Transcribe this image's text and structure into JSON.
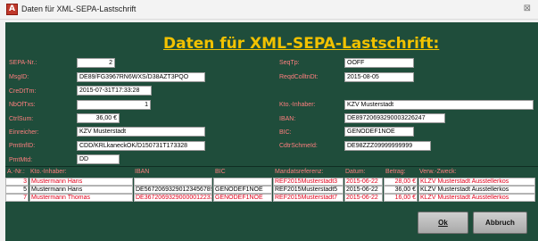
{
  "window": {
    "title": "Daten für XML-SEPA-Lastschrift",
    "close_glyph": "⊠",
    "app_icon_letter": "A"
  },
  "heading": "Daten für XML-SEPA-Lastschrift:",
  "fields_left": [
    {
      "key": "sepa_nr",
      "label": "SEPA-Nr.:",
      "value": "2"
    },
    {
      "key": "msgid",
      "label": "MsgID:",
      "value": "DE89/FG3967RN6WXS/D38AZT3PQO"
    },
    {
      "key": "credttm",
      "label": "CreDtTm:",
      "value": "2015-07-31T17:33:28"
    },
    {
      "key": "nboftxs",
      "label": "NbOfTxs:",
      "value": "1"
    },
    {
      "key": "ctrlsum",
      "label": "CtrlSum:",
      "value": "36,00 €"
    },
    {
      "key": "einreicher",
      "label": "Einreicher:",
      "value": "KZV Musterstadt"
    },
    {
      "key": "pmtinfid",
      "label": "PmtInfID:",
      "value": "CDD/KRLkaneckOK/D150731T173328"
    },
    {
      "key": "pmtmtd",
      "label": "PmtMtd:",
      "value": "DD"
    }
  ],
  "fields_right": [
    {
      "key": "seqtp",
      "label": "SeqTp:",
      "value": "OOFF"
    },
    {
      "key": "reqdcolltndt",
      "label": "ReqdColltnDt:",
      "value": "2015-08-05"
    },
    {
      "key": "kto_inhaber",
      "label": "Kto.-Inhaber:",
      "value": "KZV Musterstadt"
    },
    {
      "key": "iban",
      "label": "IBAN:",
      "value": "DE89720693290003226247"
    },
    {
      "key": "bic",
      "label": "BIC:",
      "value": "GENODEF1NOE"
    },
    {
      "key": "cdtrschmeid",
      "label": "CdtrSchmeId:",
      "value": "DE98ZZZ09999999999"
    }
  ],
  "table": {
    "headers": [
      "A.-Nr.:",
      "Kto.-Inhaber:",
      "IBAN",
      "BIC",
      "Mandatsreferenz:",
      "Datum:",
      "Betrag:",
      "Verw.-Zweck:"
    ],
    "rows": [
      {
        "nr": "3",
        "inhaber": "Mustermann Hans",
        "iban": "",
        "bic": "",
        "mandat": "REF2015Musterstadt3",
        "datum": "2015-06-22",
        "betrag": "28,00 €",
        "zweck": "KLZV Musterstadt Ausstellerkos",
        "red": true
      },
      {
        "nr": "5",
        "inhaber": "Mustermann Hans",
        "iban": "DE56720693290123456789",
        "bic": "GENODEF1NOE",
        "mandat": "REF2015Musterstadt5",
        "datum": "2015-06-22",
        "betrag": "36,00 €",
        "zweck": "KLZV Musterstadt Ausstellerkos",
        "red": false
      },
      {
        "nr": "7",
        "inhaber": "Mustermann Thomas",
        "iban": "DE36720693290000012233",
        "bic": "GENODEF1NOE",
        "mandat": "REF2015Musterstadt7",
        "datum": "2015-06-22",
        "betrag": "16,00 €",
        "zweck": "KLZV Musterstadt Ausstellerkos",
        "red": true
      }
    ]
  },
  "buttons": {
    "ok": "Ok",
    "cancel": "Abbruch"
  },
  "colors": {
    "form_bg": "#1f4d3b",
    "label": "#ff7f7f",
    "heading": "#f2c200",
    "row_red": "#e0001b"
  }
}
